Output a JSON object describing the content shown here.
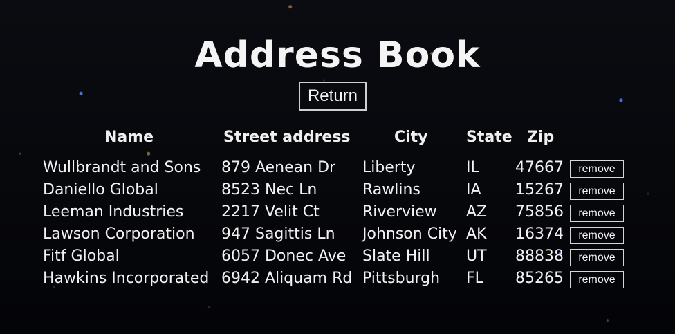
{
  "page": {
    "title": "Address Book"
  },
  "actions": {
    "return_label": "Return"
  },
  "table": {
    "columns": [
      "Name",
      "Street address",
      "City",
      "State",
      "Zip"
    ],
    "rows": [
      {
        "name": "Wullbrandt and Sons",
        "street": "879 Aenean Dr",
        "city": "Liberty",
        "state": "IL",
        "zip": "47667",
        "remove_label": "remove"
      },
      {
        "name": "Daniello Global",
        "street": "8523 Nec Ln",
        "city": "Rawlins",
        "state": "IA",
        "zip": "15267",
        "remove_label": "remove"
      },
      {
        "name": "Leeman Industries",
        "street": "2217 Velit Ct",
        "city": "Riverview",
        "state": "AZ",
        "zip": "75856",
        "remove_label": "remove"
      },
      {
        "name": "Lawson Corporation",
        "street": "947 Sagittis Ln",
        "city": "Johnson City",
        "state": "AK",
        "zip": "16374",
        "remove_label": "remove"
      },
      {
        "name": "Fitf Global",
        "street": "6057 Donec Ave",
        "city": "Slate Hill",
        "state": "UT",
        "zip": "88838",
        "remove_label": "remove"
      },
      {
        "name": "Hawkins Incorporated",
        "street": "6942 Aliquam Rd",
        "city": "Pittsburgh",
        "state": "FL",
        "zip": "85265",
        "remove_label": "remove"
      }
    ]
  },
  "colors": {
    "background": "#05060a",
    "text": "#f2f2f2",
    "border": "#cfcfcf",
    "star_blue": "#3c78ff",
    "star_warm": "#dcb478"
  }
}
